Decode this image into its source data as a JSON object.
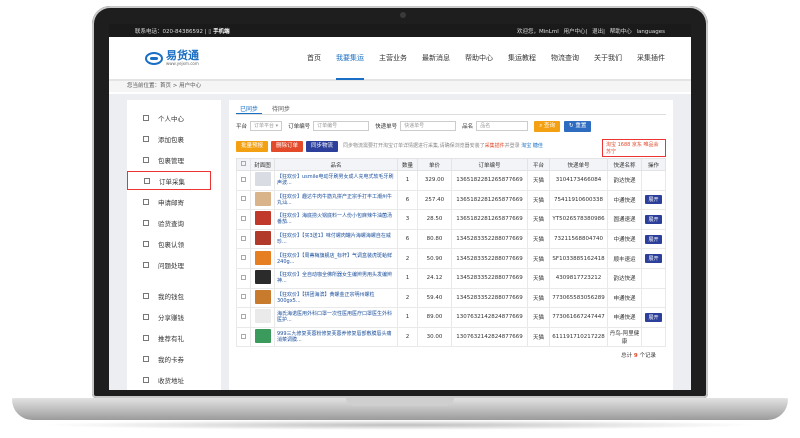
{
  "topbar": {
    "phone": "联系电话：020-84386592",
    "mobile": "手机端",
    "welcome": "欢迎您，MinLml",
    "links": [
      "用户中心",
      "退出",
      "帮助中心",
      "languages"
    ]
  },
  "logo": {
    "name": "易货通",
    "url": "www.yejxm.com"
  },
  "nav": [
    "首页",
    "我要集运",
    "主营业务",
    "最新消息",
    "帮助中心",
    "集运教程",
    "物流查询",
    "关于我们",
    "采集插件"
  ],
  "breadcrumb": "您当前位置：首页 > 用户中心",
  "sidebar": {
    "group1": [
      "个人中心",
      "添加包裹",
      "包裹管理",
      "订单采集",
      "申请邮寄",
      "验货查询",
      "包裹认领",
      "问题处理"
    ],
    "group2": [
      "我的钱包",
      "分享赚钱",
      "推荐有礼",
      "我的卡券",
      "收货地址"
    ]
  },
  "tabs": [
    "已同步",
    "待同步"
  ],
  "filters": {
    "platform_label": "平台",
    "platform_value": "订单平台",
    "order_label": "订单编号",
    "order_placeholder": "订单编号",
    "tracking_label": "快递单号",
    "tracking_placeholder": "快递单号",
    "name_label": "品名",
    "name_placeholder": "品名",
    "search": "查询",
    "reset": "重置"
  },
  "actions": {
    "predict": "批量预报",
    "delete": "删除订单",
    "sync": "同步物流",
    "notice_a": "同步物流需要打开淘宝订单详情据进行采集,请确保浏览器安装了",
    "notice_link": "采集插件",
    "notice_b": "并登录",
    "notice_c": "淘宝 糖佳",
    "platforms": "淘宝 1688 京东 唯品会 苏宁"
  },
  "table": {
    "headers": [
      "",
      "封面图",
      "品名",
      "数量",
      "单价",
      "订单编号",
      "平台",
      "快递单号",
      "快递名称",
      "操作"
    ],
    "rows": [
      {
        "name": "【狂欢价】usmile电动牙刷男女成人充电式软毛牙刷声波...",
        "qty": "1",
        "price": "329.00",
        "order": "1365182281265877669",
        "platform": "天猫",
        "tracking": "3104173466084",
        "courier": "韵达快递",
        "op": "",
        "color": "#d9dde3"
      },
      {
        "name": "【狂欢价】趣达牛肉牛筋丸拼产正宗手打丰工潮州牛丸汕...",
        "qty": "6",
        "price": "257.40",
        "order": "1365182281265877669",
        "platform": "天猫",
        "tracking": "75411910600338",
        "courier": "中通快递",
        "op": "展开",
        "color": "#d9b48b"
      },
      {
        "name": "【狂欢价】海底捞火锅底料一人份小包麻辣牛油菌汤番茄...",
        "qty": "3",
        "price": "28.50",
        "order": "1365182281265877669",
        "platform": "天猫",
        "tracking": "YT5026578380986",
        "courier": "圆通速递",
        "op": "展开",
        "color": "#c0392b"
      },
      {
        "name": "【狂欢价】【买3送1】味付螺肉罐片海螺海螺自在威珍...",
        "qty": "6",
        "price": "80.80",
        "order": "1345283352288077669",
        "platform": "天猫",
        "tracking": "73211568804740",
        "courier": "中通快递",
        "op": "展开",
        "color": "#b23a2a"
      },
      {
        "name": "【狂欢价】【周蒂梅旗舰店_标杆】气调盒装虎斑蛤鲜240g...",
        "qty": "2",
        "price": "50.90",
        "order": "1345283352288077669",
        "platform": "天猫",
        "tracking": "SF1033885162418",
        "courier": "顺丰速运",
        "op": "展开",
        "color": "#e67e22"
      },
      {
        "name": "【狂欢价】全自动咖全佛所器女生编辫男用头发编辫神...",
        "qty": "1",
        "price": "24.12",
        "order": "1345283352288077669",
        "platform": "天猫",
        "tracking": "430981772321​2",
        "courier": "韵达快递",
        "op": "",
        "color": "#2b2b2b"
      },
      {
        "name": "【狂欢价】【拼团海滨】黄螺金正宗明州螺粒300gx5...",
        "qty": "2",
        "price": "59.40",
        "order": "1345283352288077669",
        "platform": "天猫",
        "tracking": "773065583056289",
        "courier": "申通快递",
        "op": "",
        "color": "#c97b2d"
      },
      {
        "name": "海氏海诺医用外科口罩一次性医用医疗口罩医生外科医护...",
        "qty": "1",
        "price": "89.00",
        "order": "1307632142824877669",
        "platform": "天猫",
        "tracking": "773061667247447",
        "courier": "申通快递",
        "op": "展开",
        "color": "#eaeaea"
      },
      {
        "name": "999三九修复芙蓉粉修复芙蓉养修复唇部敷膜唇头痛消菜调膜...",
        "qty": "2",
        "price": "30.00",
        "order": "1307632142824877669",
        "platform": "天猫",
        "tracking": "611191710217228",
        "courier": "丹鸟-阿里健康",
        "op": "",
        "color": "#3a9b5c"
      }
    ]
  },
  "total": {
    "prefix": "总计",
    "count": "9",
    "suffix": "个记录"
  }
}
